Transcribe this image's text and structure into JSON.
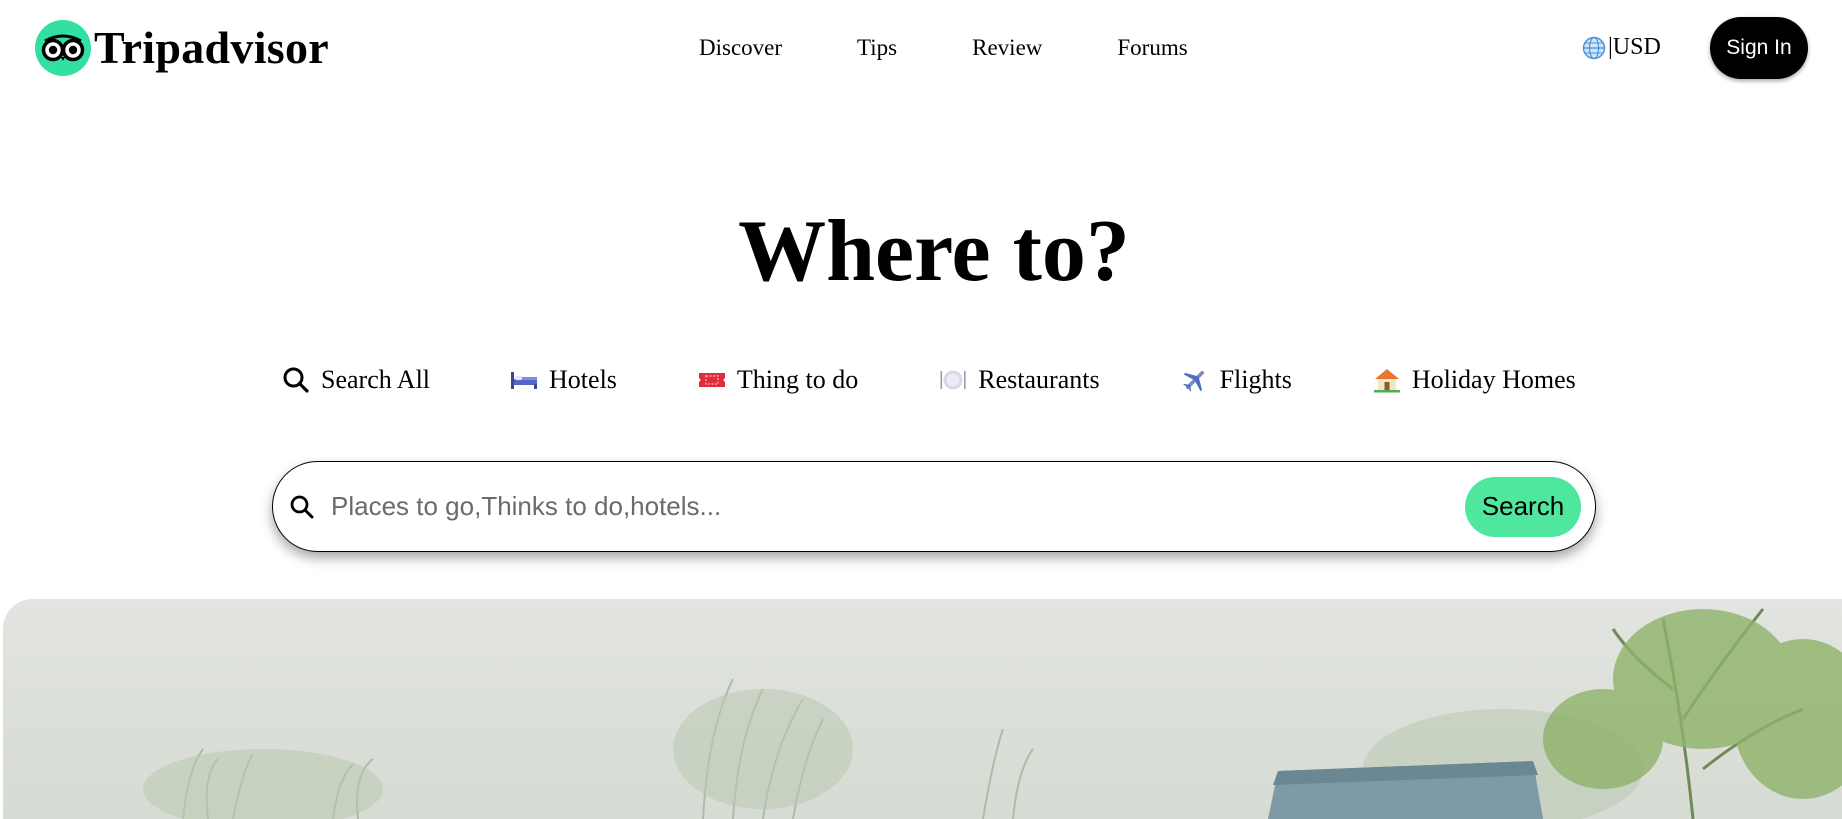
{
  "brand": {
    "name": "Tripadvisor",
    "accent": "#34e0a1"
  },
  "nav": {
    "items": [
      "Discover",
      "Tips",
      "Review",
      "Forums"
    ]
  },
  "currency": {
    "label": "|USD",
    "icon": "globe-icon"
  },
  "signin": {
    "label": "Sign In"
  },
  "hero": {
    "title": "Where to?"
  },
  "tabs": [
    {
      "label": "Search All",
      "icon": "search-icon"
    },
    {
      "label": "Hotels",
      "icon": "bed-icon"
    },
    {
      "label": "Thing to do",
      "icon": "ticket-icon"
    },
    {
      "label": "Restaurants",
      "icon": "plate-icon"
    },
    {
      "label": "Flights",
      "icon": "airplane-icon"
    },
    {
      "label": "Holiday Homes",
      "icon": "house-icon"
    }
  ],
  "search": {
    "placeholder": "Places to go,Thinks to do,hotels...",
    "button": "Search",
    "button_color": "#4ee79d"
  }
}
